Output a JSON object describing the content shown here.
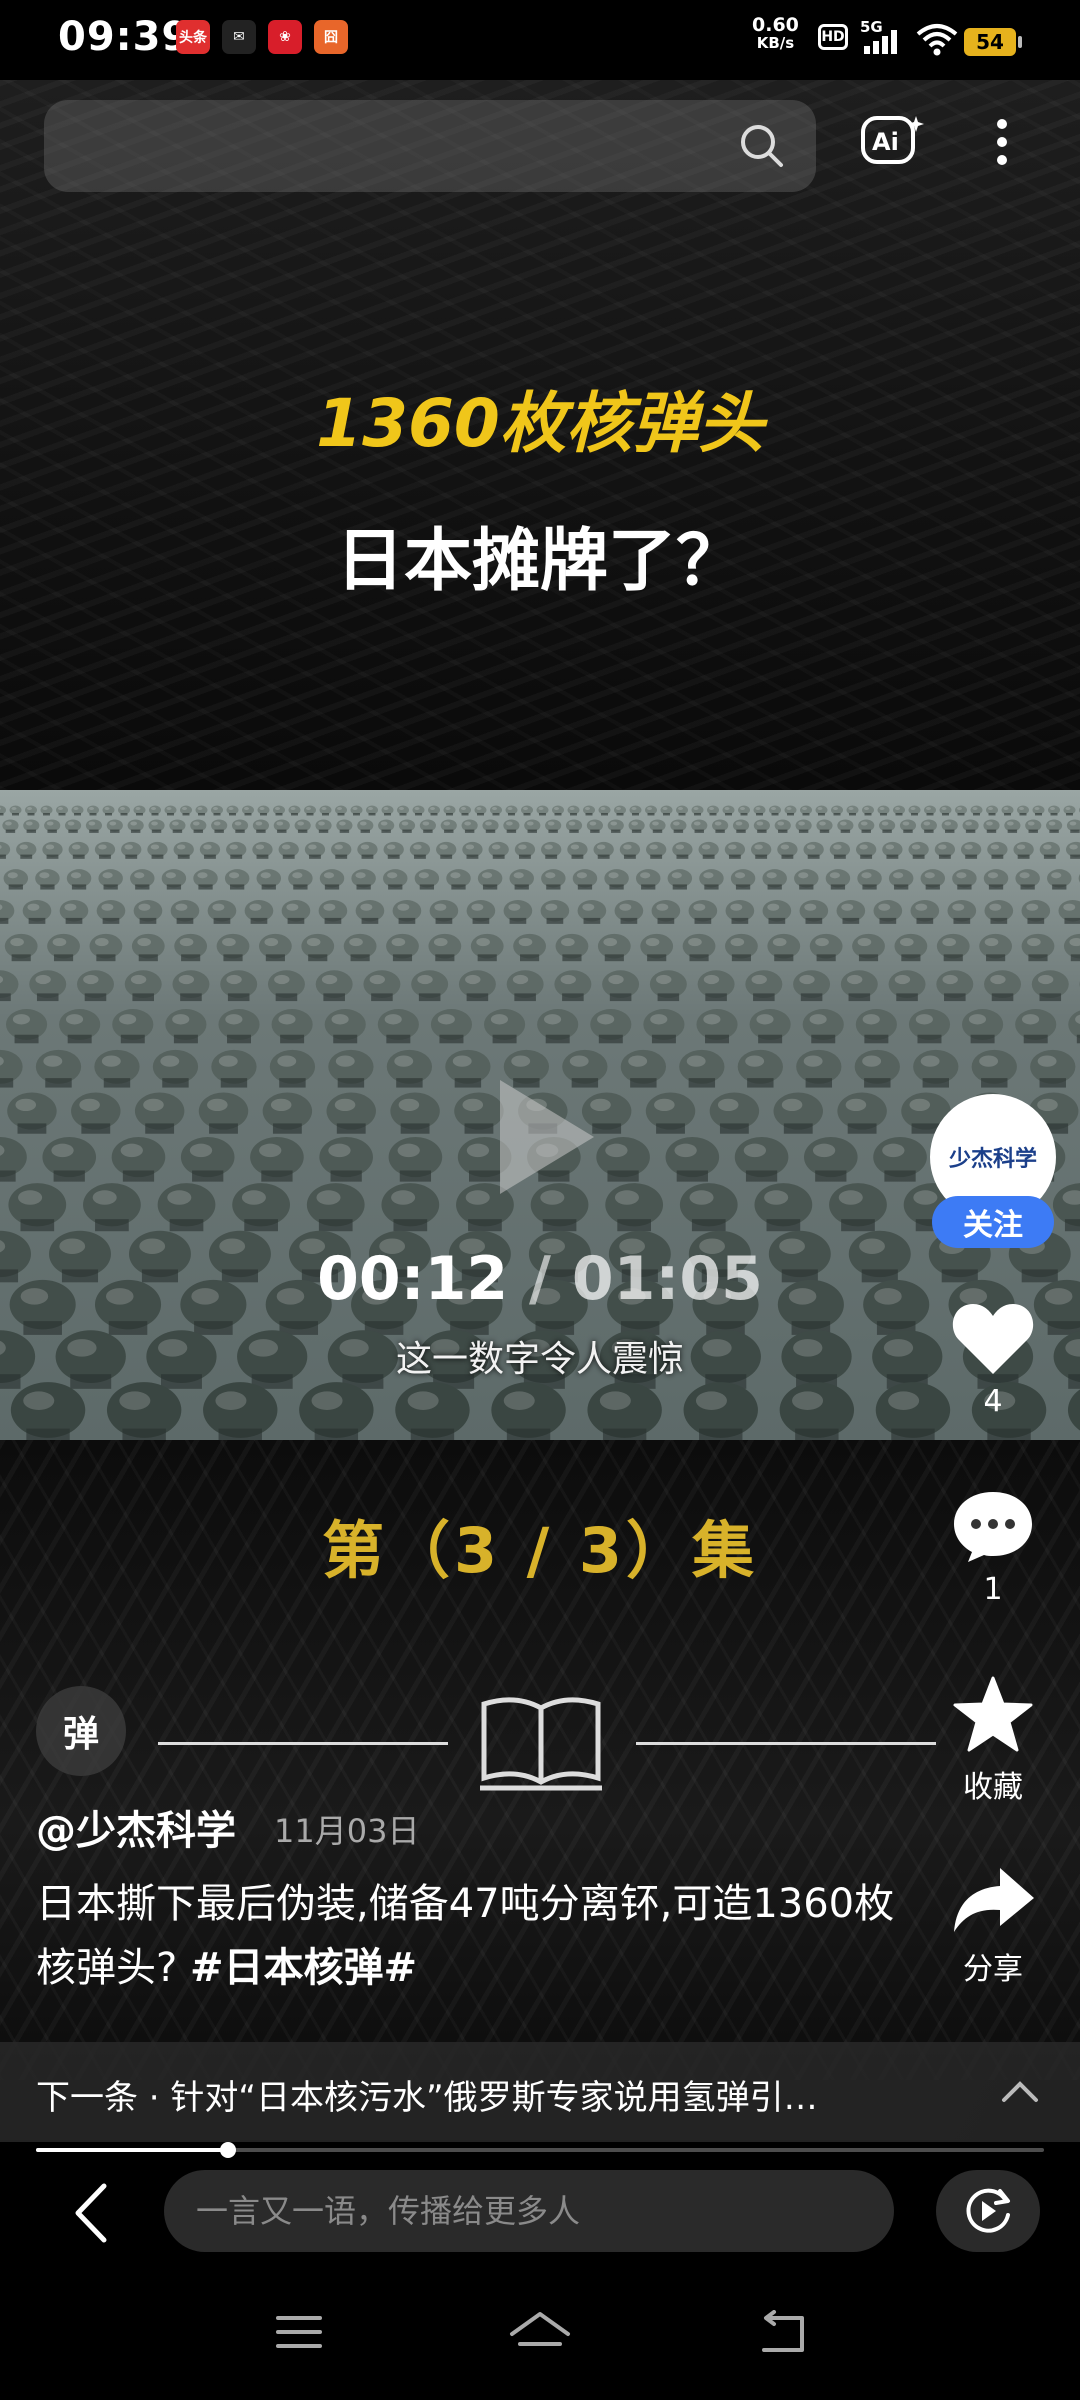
{
  "status_bar": {
    "time": "09:39",
    "net_speed_value": "0.60",
    "net_speed_unit": "KB/s",
    "hd": "HD",
    "signal": "5G",
    "battery": "54",
    "notif_icons": [
      {
        "name": "toutiao-icon",
        "text": "头条",
        "color": "#e02f2f"
      },
      {
        "name": "message-icon",
        "text": "✉",
        "color": "#222"
      },
      {
        "name": "app-red-icon",
        "text": "❀",
        "color": "#d81e2a"
      },
      {
        "name": "app-orange-icon",
        "text": "囧",
        "color": "#e8662a"
      }
    ]
  },
  "video": {
    "title_line1": "1360枚核弹头",
    "title_line2": "日本摊牌了？",
    "current_time": "00:12",
    "separator": "/",
    "total_time": "01:05",
    "subtitle": "这一数字令人震惊",
    "episode": "第（3 / 3）集",
    "progress_fraction": 0.19
  },
  "danmu_label": "弹",
  "sidebar": {
    "avatar_text": "少杰科学",
    "follow_label": "关注",
    "like_count": "4",
    "comment_count": "1",
    "favorite_label": "收藏",
    "share_label": "分享"
  },
  "post": {
    "author": "@少杰科学",
    "date": "11月03日",
    "caption": "日本撕下最后伪装,储备47吨分离钚,可造1360枚核弹头?",
    "hashtag": "#日本核弹#"
  },
  "next": {
    "text": "下一条 · 针对“日本核污水”俄罗斯专家说用氢弹引…"
  },
  "comment_bar": {
    "placeholder": "一言又一语，传播给更多人"
  },
  "colors": {
    "accent_blue": "#3d7bf5",
    "title_yellow": "#f0c61a",
    "episode_gold": "#d8b22a",
    "battery": "#e6b21d"
  }
}
